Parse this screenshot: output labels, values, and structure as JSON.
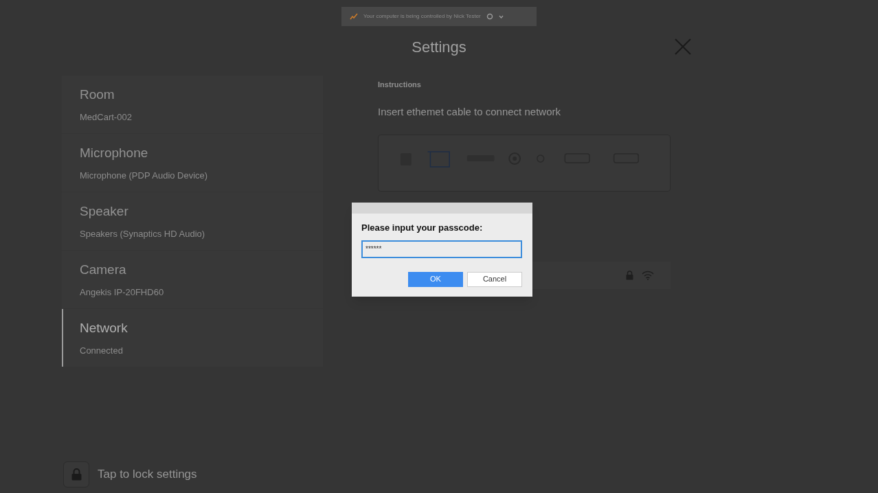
{
  "banner": {
    "text": "Your computer is being controlled by Nick Tester"
  },
  "title": "Settings",
  "sidebar": {
    "items": [
      {
        "label": "Room",
        "value": "MedCart-002",
        "selected": false
      },
      {
        "label": "Microphone",
        "value": "Microphone (PDP Audio Device)",
        "selected": false
      },
      {
        "label": "Speaker",
        "value": "Speakers (Synaptics HD Audio)",
        "selected": false
      },
      {
        "label": "Camera",
        "value": "Angekis IP-20FHD60",
        "selected": false
      },
      {
        "label": "Network",
        "value": "Connected",
        "selected": true
      }
    ]
  },
  "instructions": {
    "heading": "Instructions",
    "text": "Insert ethemet cable to connect network"
  },
  "dialog": {
    "prompt": "Please input your passcode:",
    "value": "******",
    "buttons": [
      {
        "label": "OK",
        "kind": "primary"
      },
      {
        "label": "Cancel",
        "kind": "secondary"
      }
    ]
  },
  "lock": {
    "label": "Tap to lock settings"
  }
}
